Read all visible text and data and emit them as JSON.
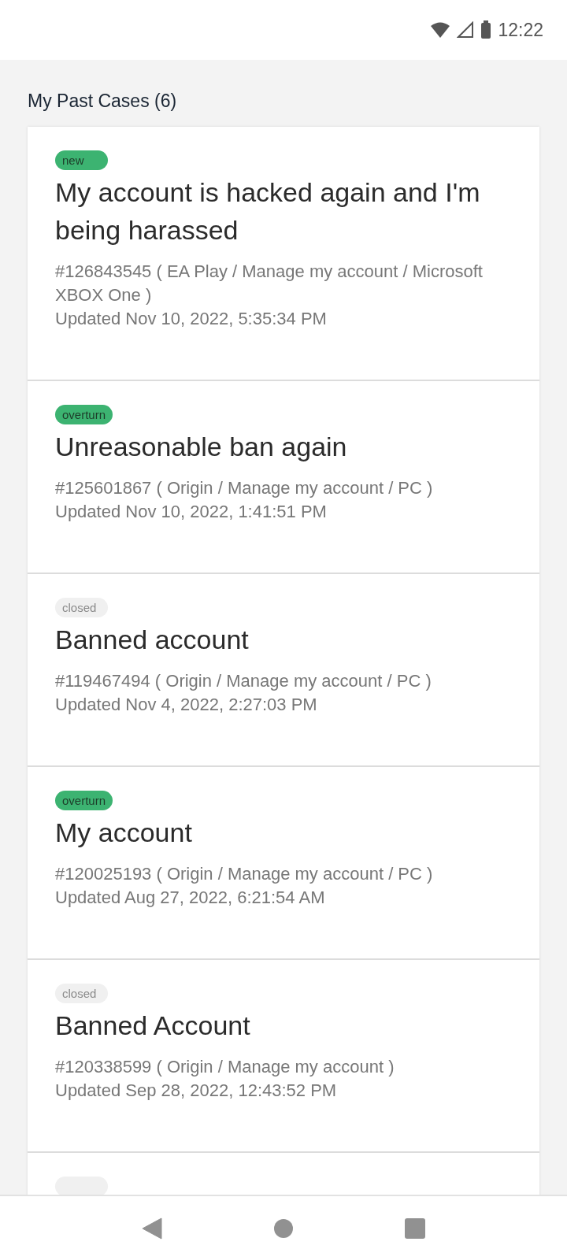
{
  "status_bar": {
    "time": "12:22"
  },
  "heading": "My Past Cases (6)",
  "cases": [
    {
      "badge": {
        "text": "new",
        "kind": "new"
      },
      "title": "My account is hacked again and I'm being harassed",
      "meta": "#126843545 ( EA Play / Manage my account / Microsoft XBOX One )",
      "updated": "Updated Nov 10, 2022, 5:35:34 PM"
    },
    {
      "badge": {
        "text": "overturn",
        "kind": "overturn"
      },
      "title": "Unreasonable ban again",
      "meta": "#125601867 ( Origin / Manage my account / PC )",
      "updated": "Updated Nov 10, 2022, 1:41:51 PM"
    },
    {
      "badge": {
        "text": "closed",
        "kind": "closed"
      },
      "title": "Banned account",
      "meta": "#119467494 ( Origin / Manage my account / PC )",
      "updated": "Updated Nov 4, 2022, 2:27:03 PM"
    },
    {
      "badge": {
        "text": "overturn",
        "kind": "overturn"
      },
      "title": "My account",
      "meta": "#120025193 ( Origin / Manage my account / PC )",
      "updated": "Updated Aug 27, 2022, 6:21:54 AM"
    },
    {
      "badge": {
        "text": "closed",
        "kind": "closed"
      },
      "title": "Banned Account",
      "meta": "#120338599 ( Origin / Manage my account )",
      "updated": "Updated Sep 28, 2022, 12:43:52 PM"
    },
    {
      "badge": {
        "kind": "closed"
      }
    }
  ]
}
